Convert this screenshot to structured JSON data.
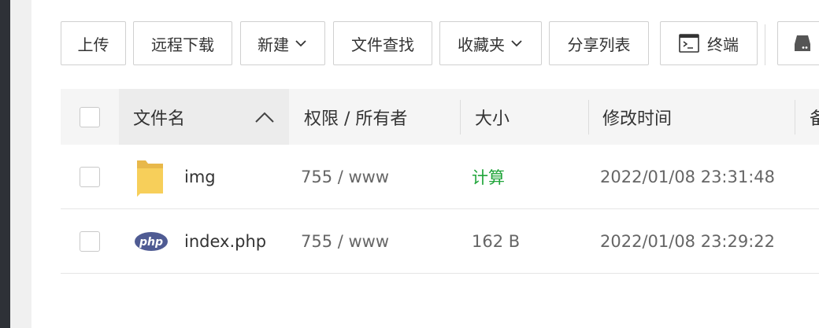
{
  "toolbar": {
    "upload": "上传",
    "remote_download": "远程下载",
    "new": "新建",
    "file_search": "文件查找",
    "favorites": "收藏夹",
    "share_list": "分享列表",
    "terminal": "终端"
  },
  "table": {
    "headers": {
      "name": "文件名",
      "permission": "权限 / 所有者",
      "size": "大小",
      "modified": "修改时间",
      "note": "备"
    },
    "rows": [
      {
        "name": "img",
        "icon": "folder-icon",
        "permission": "755 / www",
        "size": "计算",
        "modified": "2022/01/08 23:31:48"
      },
      {
        "name": "index.php",
        "icon": "php-file-icon",
        "permission": "755 / www",
        "size": "162 B",
        "modified": "2022/01/08 23:29:22"
      }
    ]
  },
  "colors": {
    "sidebar_dark": "#2e3137",
    "calc_green": "#20a53a",
    "folder_yellow": "#f7cf5a",
    "php_blue": "#4f5b93"
  }
}
